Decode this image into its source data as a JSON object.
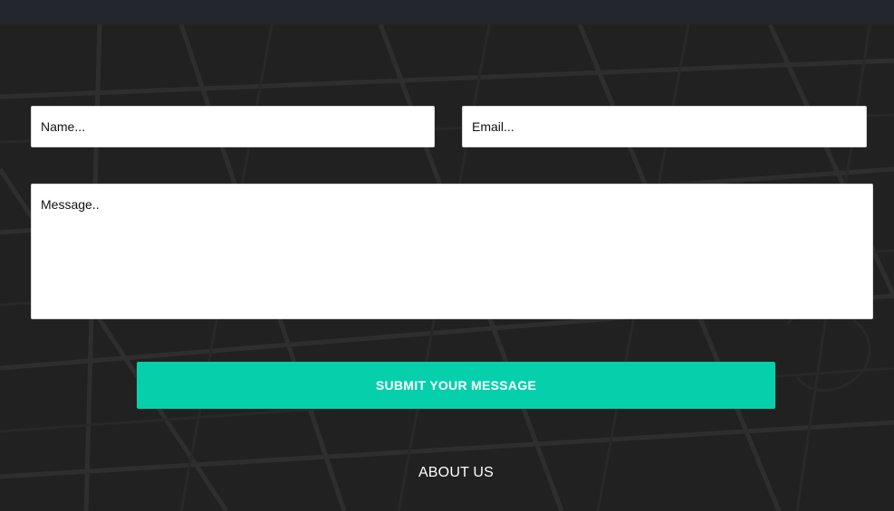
{
  "form": {
    "name_placeholder": "Name...",
    "email_placeholder": "Email...",
    "message_placeholder": "Message..",
    "submit_label": "SUBMIT YOUR MESSAGE"
  },
  "footer": {
    "about_heading": "ABOUT US"
  },
  "colors": {
    "background": "#212121",
    "top_strip": "#23262c",
    "accent": "#06d0ab",
    "field_background": "#ffffff"
  }
}
